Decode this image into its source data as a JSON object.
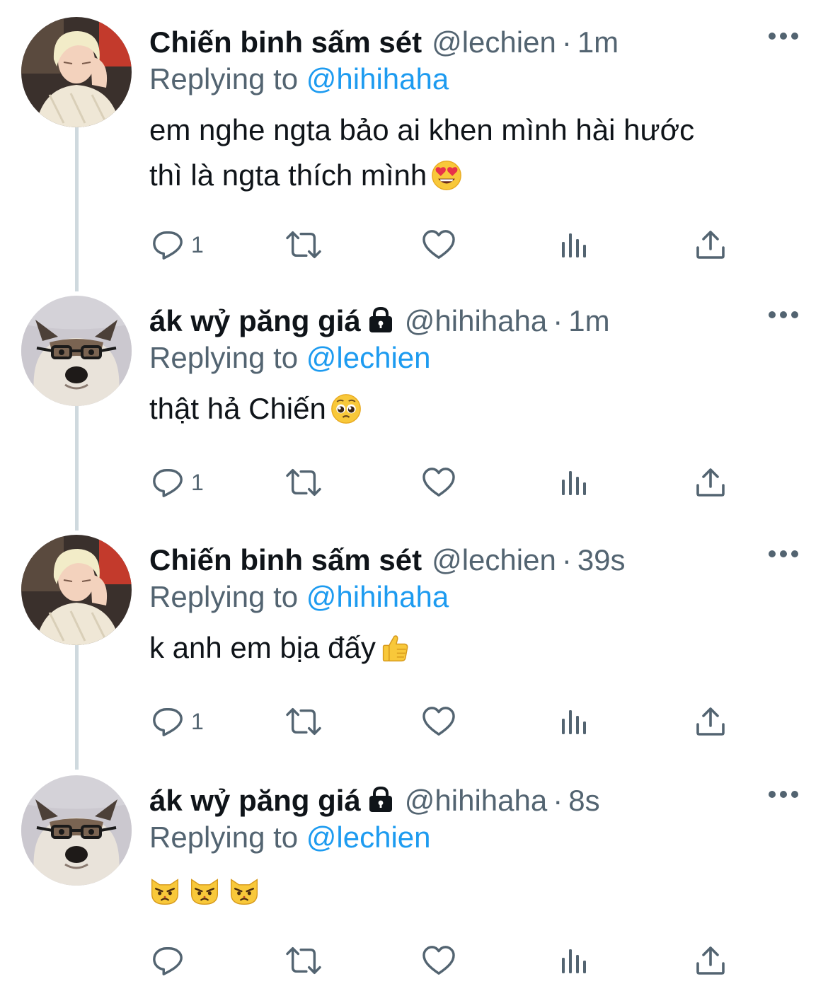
{
  "tweets": [
    {
      "name": "Chiến binh sấm sét",
      "handle": "@lechien",
      "dot": "·",
      "time": "1m",
      "locked": false,
      "replying_label": "Replying to",
      "replying_to": "@hihihaha",
      "text_line1": "em nghe ngta bảo ai khen mình hài hước",
      "text_line2": "thì là ngta thích mình",
      "emoji": "smiling-face-with-heart-eyes",
      "reply_count": "1",
      "avatar": "blonde-person-avatar"
    },
    {
      "name": "ák wỷ păng giá",
      "handle": "@hihihaha",
      "dot": "·",
      "time": "1m",
      "locked": true,
      "replying_label": "Replying to",
      "replying_to": "@lechien",
      "text_line1": "thật hả Chiến",
      "emoji": "pleading-face",
      "reply_count": "1",
      "avatar": "dog-with-glasses-avatar"
    },
    {
      "name": "Chiến binh sấm sét",
      "handle": "@lechien",
      "dot": "·",
      "time": "39s",
      "locked": false,
      "replying_label": "Replying to",
      "replying_to": "@hihihaha",
      "text_line1": "k anh em bịa đấy",
      "emoji": "thumbs-up",
      "reply_count": "1",
      "avatar": "blonde-person-avatar"
    },
    {
      "name": "ák wỷ păng giá",
      "handle": "@hihihaha",
      "dot": "·",
      "time": "8s",
      "locked": true,
      "replying_label": "Replying to",
      "replying_to": "@lechien",
      "emoji": "pouting-cat-x3",
      "reply_count": "",
      "avatar": "dog-with-glasses-avatar"
    }
  ],
  "colors": {
    "text": "#0f1419",
    "secondary": "#536471",
    "link": "#1d9bf0",
    "thread_line": "#cfd9de"
  }
}
